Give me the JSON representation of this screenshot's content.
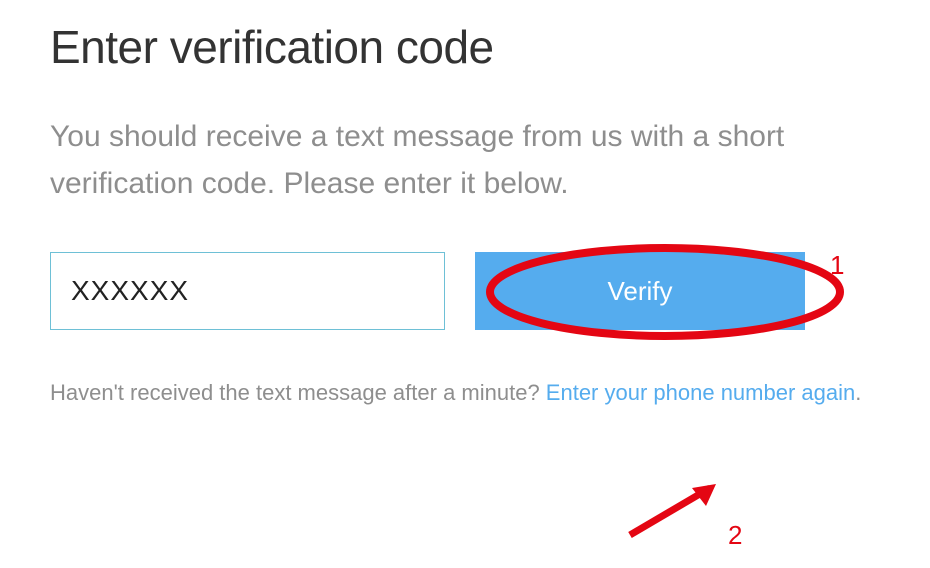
{
  "heading": "Enter verification code",
  "description": "You should receive a text message from us with a short verification code. Please enter it below.",
  "input": {
    "value": "XXXXXX",
    "placeholder": ""
  },
  "verify_button": "Verify",
  "footer": {
    "prefix": "Haven't received the text message after a minute? ",
    "link": "Enter your phone number again",
    "suffix": "."
  },
  "annotations": {
    "num1": "1",
    "num2": "2"
  }
}
